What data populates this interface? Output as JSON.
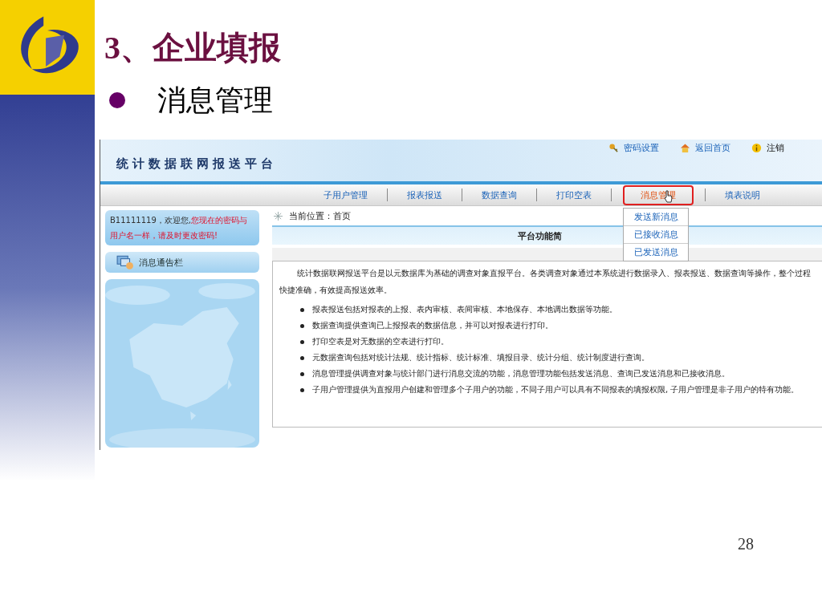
{
  "slide": {
    "title": "3、企业填报",
    "bullet": "消息管理",
    "page_number": "28"
  },
  "app": {
    "title": "统计数据联网报送平台",
    "top_links": [
      {
        "label": "密码设置",
        "kind": "key"
      },
      {
        "label": "返回首页",
        "kind": "home"
      },
      {
        "label": "注销",
        "kind": "info"
      }
    ],
    "nav": [
      {
        "label": "子用户管理",
        "selected": false
      },
      {
        "label": "报表报送",
        "selected": false
      },
      {
        "label": "数据查询",
        "selected": false
      },
      {
        "label": "打印空表",
        "selected": false
      },
      {
        "label": "消息管理",
        "selected": true
      },
      {
        "label": "填表说明",
        "selected": false
      }
    ],
    "dropdown": [
      "发送新消息",
      "已接收消息",
      "已发送消息"
    ],
    "welcome": {
      "greeting": "B11111119，欢迎您,",
      "warning": "您现在的密码与用户名一样，请及时更改密码!"
    },
    "notice_bar": "消息通告栏",
    "breadcrumb": "当前位置：首页",
    "section_title": "平台功能简",
    "intro": "统计数据联网报送平台是以元数据库为基础的调查对象直报平台。各类调查对象通过本系统进行数据录入、报表报送、数据查询等操作，整个过程快捷准确，有效提高报送效率。",
    "features": [
      "报表报送包括对报表的上报、表内审核、表间审核、本地保存、本地调出数据等功能。",
      "数据查询提供查询已上报报表的数据信息，并可以对报表进行打印。",
      "打印空表是对无数据的空表进行打印。",
      "元数据查询包括对统计法规、统计指标、统计标准、填报目录、统计分组、统计制度进行查询。",
      "消息管理提供调查对象与统计部门进行消息交流的功能，消息管理功能包括发送消息、查询已发送消息和已接收消息。",
      "子用户管理提供为直报用户创建和管理多个子用户的功能，不同子用户可以具有不同报表的填报权限, 子用户管理是非子用户的特有功能。"
    ]
  }
}
